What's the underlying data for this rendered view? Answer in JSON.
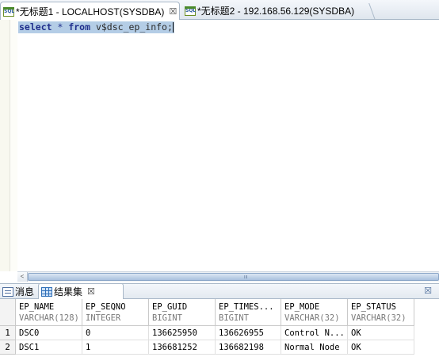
{
  "editor_tabs": [
    {
      "label": "*无标题1 - LOCALHOST(SYSDBA)",
      "close": "☒",
      "icon": "sql-file-icon",
      "active": true
    },
    {
      "label": "*无标题2 - 192.168.56.129(SYSDBA)",
      "icon": "sql-file-icon",
      "active": false
    }
  ],
  "editor": {
    "sql": {
      "kw1": "select",
      "star": " * ",
      "kw2": "from",
      "rest": " v$dsc_ep_info;"
    }
  },
  "hscroll": {
    "left_arrow": "<",
    "grip": "III"
  },
  "result_tabs": {
    "messages": "消息",
    "resultset": "结果集",
    "close": "☒",
    "restore": "☒"
  },
  "result": {
    "columns": [
      {
        "name": "EP_NAME",
        "type": "VARCHAR(128)"
      },
      {
        "name": "EP_SEQNO",
        "type": "INTEGER"
      },
      {
        "name": "EP_GUID",
        "type": "BIGINT"
      },
      {
        "name": "EP_TIMES...",
        "type": "BIGINT"
      },
      {
        "name": "EP_MODE",
        "type": "VARCHAR(32)"
      },
      {
        "name": "EP_STATUS",
        "type": "VARCHAR(32)"
      }
    ],
    "rows": [
      {
        "num": "1",
        "cells": [
          "DSC0",
          "0",
          "136625950",
          "136626955",
          "Control N...",
          "OK"
        ]
      },
      {
        "num": "2",
        "cells": [
          "DSC1",
          "1",
          "136681252",
          "136682198",
          "Normal Node",
          "OK"
        ]
      }
    ]
  }
}
